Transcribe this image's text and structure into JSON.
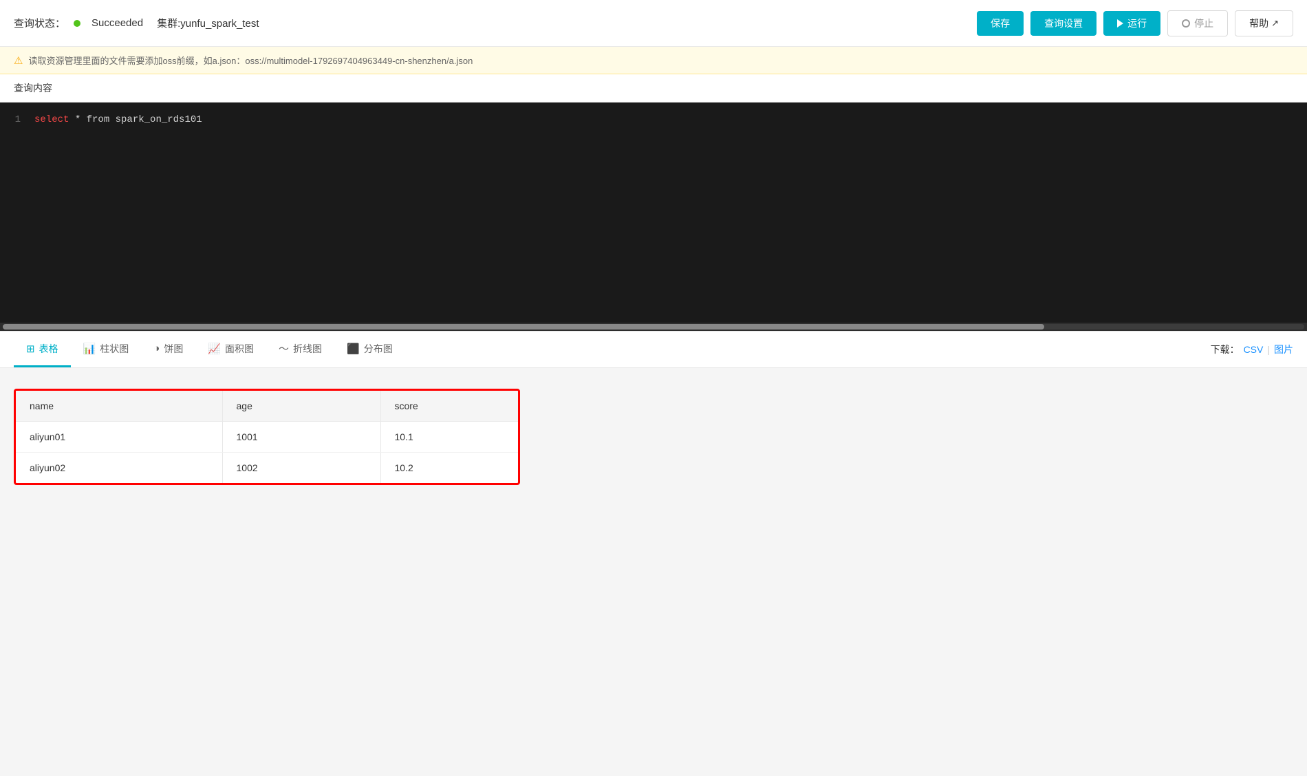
{
  "header": {
    "query_status_label": "查询状态：",
    "status": "Succeeded",
    "cluster": "集群:yunfu_spark_test",
    "buttons": {
      "save": "保存",
      "query_settings": "查询设置",
      "run": "运行",
      "stop": "停止",
      "help": "帮助"
    }
  },
  "warning": {
    "text": "读取资源管理里面的文件需要添加oss前缀，如a.json：oss://multimodel-1792697404963449-cn-shenzhen/a.json"
  },
  "query_section": {
    "title": "查询内容",
    "line_number": "1",
    "code_keyword": "select",
    "code_rest": " * from spark_on_rds101"
  },
  "tabs": {
    "items": [
      {
        "icon": "⊞",
        "label": "表格",
        "active": true
      },
      {
        "icon": "📊",
        "label": "柱状图",
        "active": false
      },
      {
        "icon": "◑",
        "label": "饼图",
        "active": false
      },
      {
        "icon": "📈",
        "label": "面积图",
        "active": false
      },
      {
        "icon": "〜",
        "label": "折线图",
        "active": false
      },
      {
        "icon": "⬛",
        "label": "分布图",
        "active": false
      }
    ],
    "download_label": "下载：",
    "download_csv": "CSV",
    "download_img": "图片",
    "separator": "|"
  },
  "table": {
    "columns": [
      "name",
      "age",
      "score"
    ],
    "rows": [
      {
        "name": "aliyun01",
        "age": "1001",
        "score": "10.1"
      },
      {
        "name": "aliyun02",
        "age": "1002",
        "score": "10.2"
      }
    ]
  }
}
